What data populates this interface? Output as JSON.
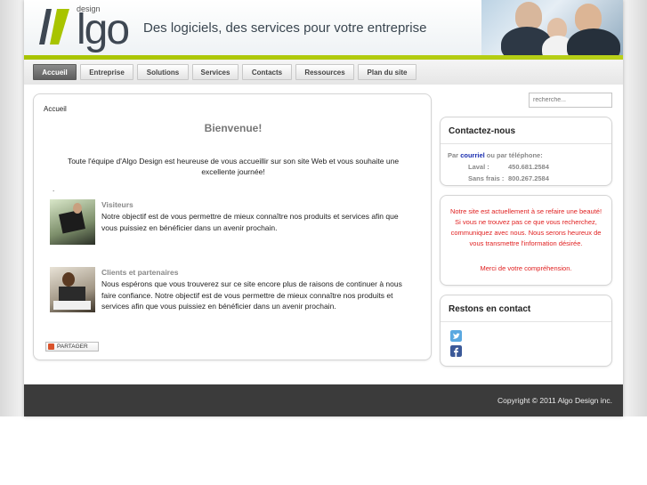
{
  "header": {
    "logo_small": "design",
    "logo_text": "lgo",
    "tagline": "Des logiciels, des services pour votre entreprise"
  },
  "nav": {
    "items": [
      {
        "label": "Accueil",
        "active": true
      },
      {
        "label": "Entreprise"
      },
      {
        "label": "Solutions"
      },
      {
        "label": "Services"
      },
      {
        "label": "Contacts"
      },
      {
        "label": "Ressources"
      },
      {
        "label": "Plan du site"
      }
    ]
  },
  "main": {
    "breadcrumb": "Accueil",
    "welcome": "Bienvenue!",
    "intro": "Toute l'équipe d'Algo Design est heureuse de vous accueillir sur son site Web et vous souhaite une excellente journée!",
    "dot": ".",
    "sections": [
      {
        "title": "Visiteurs",
        "text": "Notre objectif est de vous permettre de mieux connaître nos produits et services afin que vous puissiez en bénéficier dans un avenir prochain."
      },
      {
        "title": "Clients et partenaires",
        "text": "Nous espérons que vous trouverez sur ce site encore plus de raisons de continuer à nous faire confiance. Notre objectif est de vous permettre de mieux connaître nos produits et services afin que vous puissiez en bénéficier dans un avenir prochain."
      }
    ],
    "share_label": "PARTAGER"
  },
  "sidebar": {
    "search_placeholder": "recherche...",
    "contact": {
      "title": "Contactez-nous",
      "line_prefix": "Par",
      "link": "courriel",
      "line_suffix": "ou par téléphone:",
      "phone1_label": "Laval :",
      "phone1": "450.681.2584",
      "phone2_label": "Sans frais :",
      "phone2": "800.267.2584"
    },
    "notice": {
      "text": "Notre site est actuellement à se refaire une beauté! Si vous ne trouvez pas ce que vous recherchez, communiquez avec nous. Nous serons heureux de vous transmettre l'information désirée.",
      "thanks": "Merci de votre compréhension."
    },
    "social": {
      "title": "Restons en contact"
    }
  },
  "footer": {
    "copyright": "Copyright © 2011 Algo Design inc."
  },
  "colors": {
    "accent_green": "#a8c400",
    "footer_bg": "#3b3b3b",
    "notice_red": "#e02020",
    "link_blue": "#1a2eb0",
    "twitter": "#5aa8e0",
    "facebook": "#3b5998"
  },
  "icons": [
    "logo-mark-icon",
    "share-icon",
    "twitter-icon",
    "facebook-icon"
  ]
}
